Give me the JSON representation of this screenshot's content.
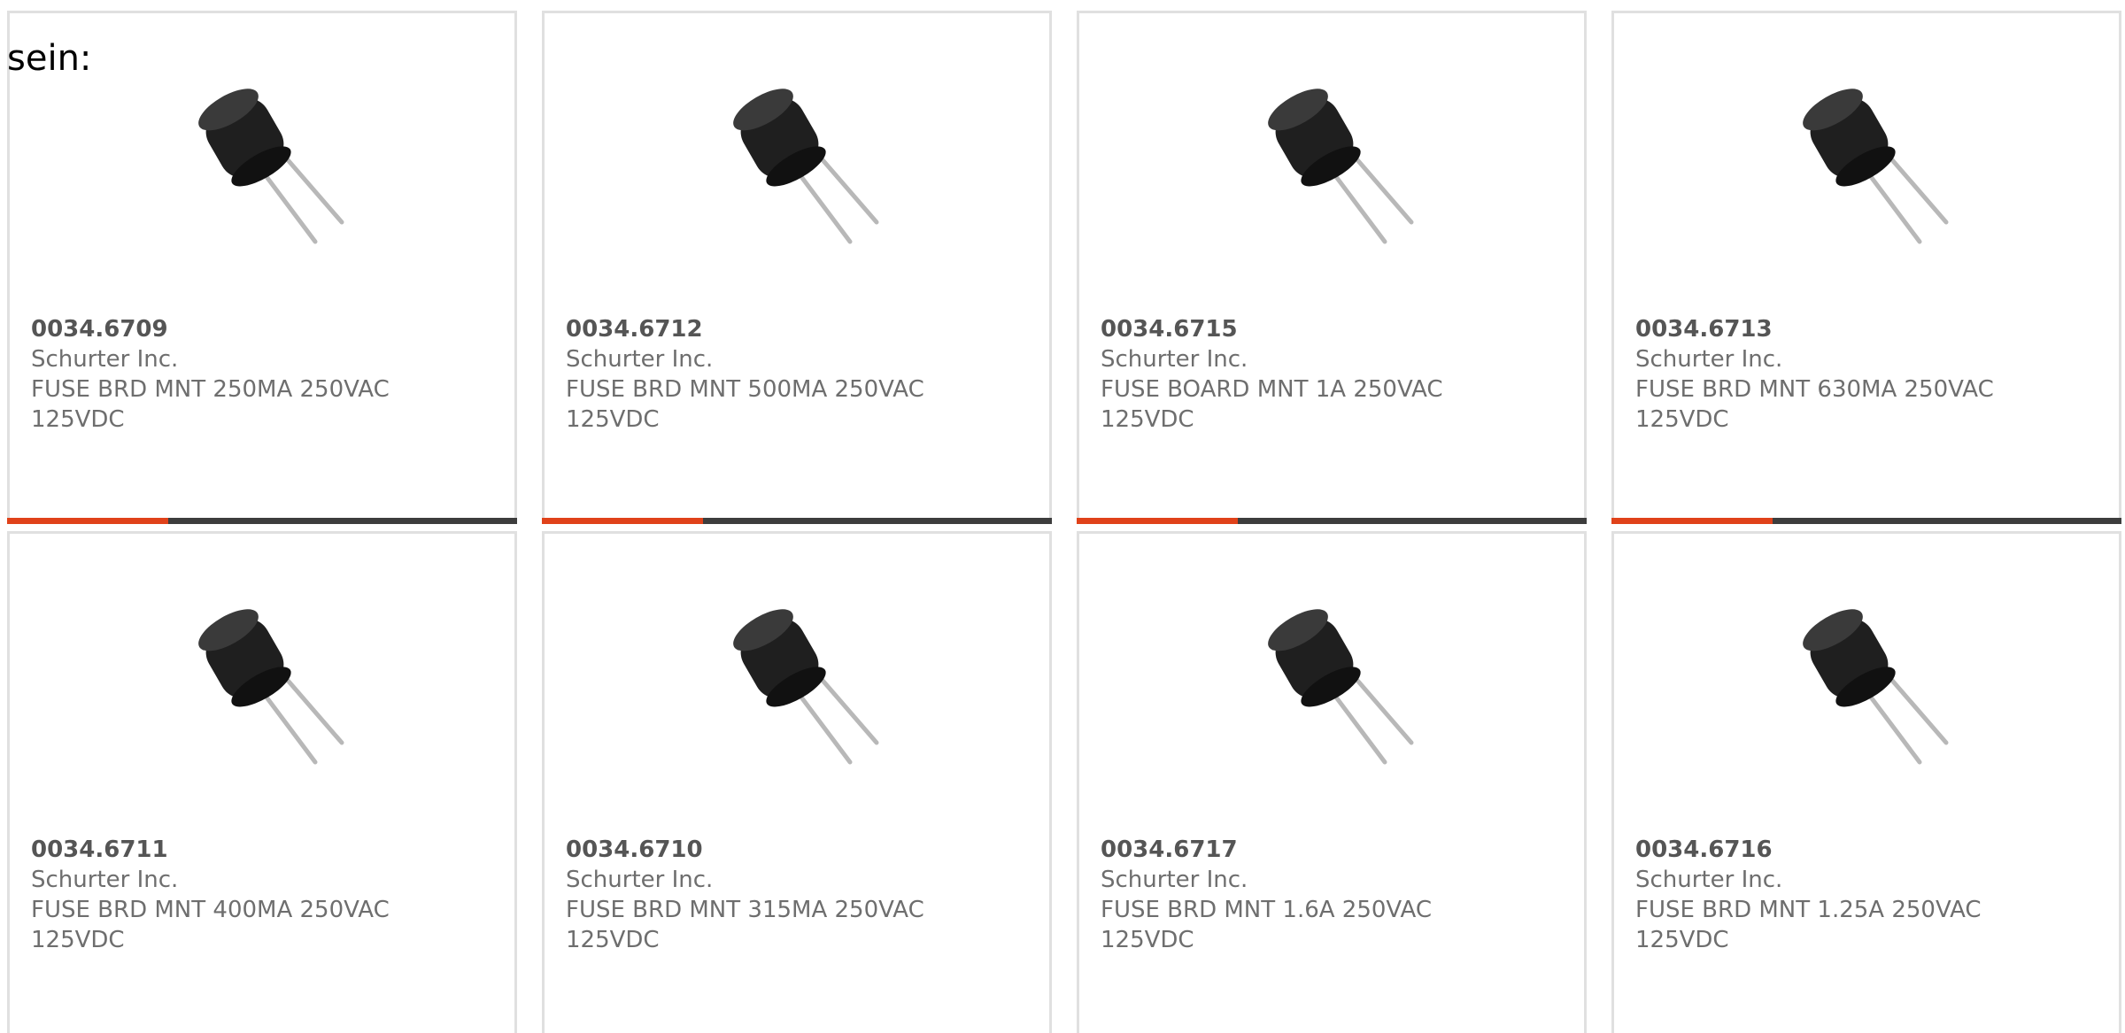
{
  "intro_text": "sein:",
  "colors": {
    "accent": "#e0421a",
    "bar": "#3d3d3d",
    "text": "#6e6e6e",
    "card_border": "#e0e0e0"
  },
  "products": [
    {
      "part_number": "0034.6709",
      "manufacturer": "Schurter Inc.",
      "description": "FUSE BRD MNT 250MA 250VAC 125VDC",
      "image_icon": "radial-fuse-icon"
    },
    {
      "part_number": "0034.6712",
      "manufacturer": "Schurter Inc.",
      "description": "FUSE BRD MNT 500MA 250VAC 125VDC",
      "image_icon": "radial-fuse-icon"
    },
    {
      "part_number": "0034.6715",
      "manufacturer": "Schurter Inc.",
      "description": "FUSE BOARD MNT 1A 250VAC 125VDC",
      "image_icon": "radial-fuse-icon"
    },
    {
      "part_number": "0034.6713",
      "manufacturer": "Schurter Inc.",
      "description": "FUSE BRD MNT 630MA 250VAC 125VDC",
      "image_icon": "radial-fuse-icon"
    },
    {
      "part_number": "0034.6711",
      "manufacturer": "Schurter Inc.",
      "description": "FUSE BRD MNT 400MA 250VAC 125VDC",
      "image_icon": "radial-fuse-icon"
    },
    {
      "part_number": "0034.6710",
      "manufacturer": "Schurter Inc.",
      "description": "FUSE BRD MNT 315MA 250VAC 125VDC",
      "image_icon": "radial-fuse-icon"
    },
    {
      "part_number": "0034.6717",
      "manufacturer": "Schurter Inc.",
      "description": "FUSE BRD MNT 1.6A 250VAC 125VDC",
      "image_icon": "radial-fuse-icon"
    },
    {
      "part_number": "0034.6716",
      "manufacturer": "Schurter Inc.",
      "description": "FUSE BRD MNT 1.25A 250VAC 125VDC",
      "image_icon": "radial-fuse-icon"
    }
  ]
}
